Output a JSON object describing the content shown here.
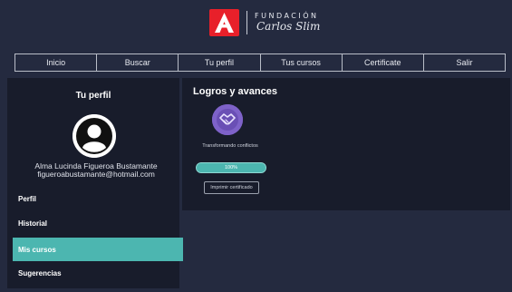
{
  "brand": {
    "logo_letter": "A",
    "name": "FUNDACIÓN",
    "subtitle": "Carlos Slim",
    "logo_color": "#e8202a"
  },
  "nav": {
    "items": [
      {
        "label": "Inicio"
      },
      {
        "label": "Buscar"
      },
      {
        "label": "Tu perfil"
      },
      {
        "label": "Tus cursos"
      },
      {
        "label": "Certificate"
      },
      {
        "label": "Salir"
      }
    ]
  },
  "sidebar": {
    "title": "Tu perfil",
    "avatar_icon": "user-avatar-icon",
    "user_name": "Alma Lucinda Figueroa Bustamante",
    "user_email": "figueroabustamante@hotmail.com",
    "items": [
      {
        "label": "Perfil",
        "active": false
      },
      {
        "label": "Historial",
        "active": false
      },
      {
        "label": "Mis cursos",
        "active": true
      },
      {
        "label": "Sugerencias",
        "active": false
      }
    ],
    "active_color": "#4cb6b0"
  },
  "main": {
    "title": "Logros y avances",
    "achievement": {
      "icon": "handshake-badge-icon",
      "badge_color": "#7e62c9",
      "label": "Transformando conflictos",
      "progress_text": "100%",
      "progress": 1.0,
      "print_label": "Imprimir certificado"
    }
  }
}
